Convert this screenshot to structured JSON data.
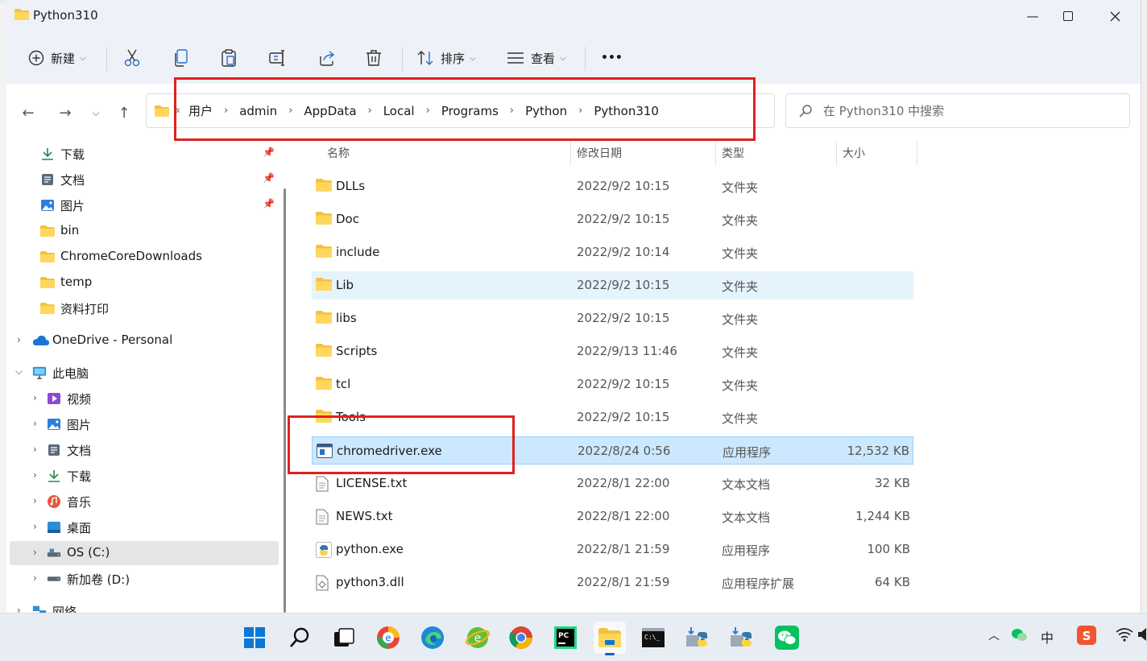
{
  "window": {
    "title": "Python310"
  },
  "toolbar": {
    "new_label": "新建",
    "sort_label": "排序",
    "view_label": "查看",
    "more_label": "•••"
  },
  "address": {
    "overflow": "«",
    "crumbs": [
      "用户",
      "admin",
      "AppData",
      "Local",
      "Programs",
      "Python",
      "Python310"
    ],
    "search_placeholder": "在 Python310 中搜索"
  },
  "nav": {
    "quick": [
      {
        "label": "下载",
        "icon": "download-icon",
        "pinned": true
      },
      {
        "label": "文档",
        "icon": "document-icon",
        "pinned": true
      },
      {
        "label": "图片",
        "icon": "picture-icon",
        "pinned": true
      },
      {
        "label": "bin",
        "icon": "folder-icon"
      },
      {
        "label": "ChromeCoreDownloads",
        "icon": "folder-icon"
      },
      {
        "label": "temp",
        "icon": "folder-icon"
      },
      {
        "label": "资料打印",
        "icon": "folder-icon"
      }
    ],
    "onedrive": "OneDrive - Personal",
    "thispc": "此电脑",
    "pc_items": [
      {
        "label": "视频",
        "icon": "video-icon"
      },
      {
        "label": "图片",
        "icon": "picture-icon"
      },
      {
        "label": "文档",
        "icon": "document-icon"
      },
      {
        "label": "下载",
        "icon": "download-icon"
      },
      {
        "label": "音乐",
        "icon": "music-icon"
      },
      {
        "label": "桌面",
        "icon": "desktop-icon"
      },
      {
        "label": "OS (C:)",
        "icon": "drive-icon"
      },
      {
        "label": "新加卷 (D:)",
        "icon": "drive-icon"
      }
    ],
    "network": "网络"
  },
  "columns": {
    "name": "名称",
    "date": "修改日期",
    "type": "类型",
    "size": "大小"
  },
  "files": [
    {
      "name": "DLLs",
      "date": "2022/9/2 10:15",
      "type": "文件夹",
      "size": "",
      "icon": "folder-icon"
    },
    {
      "name": "Doc",
      "date": "2022/9/2 10:15",
      "type": "文件夹",
      "size": "",
      "icon": "folder-icon"
    },
    {
      "name": "include",
      "date": "2022/9/2 10:14",
      "type": "文件夹",
      "size": "",
      "icon": "folder-icon"
    },
    {
      "name": "Lib",
      "date": "2022/9/2 10:15",
      "type": "文件夹",
      "size": "",
      "icon": "folder-icon"
    },
    {
      "name": "libs",
      "date": "2022/9/2 10:15",
      "type": "文件夹",
      "size": "",
      "icon": "folder-icon"
    },
    {
      "name": "Scripts",
      "date": "2022/9/13 11:46",
      "type": "文件夹",
      "size": "",
      "icon": "folder-icon"
    },
    {
      "name": "tcl",
      "date": "2022/9/2 10:15",
      "type": "文件夹",
      "size": "",
      "icon": "folder-icon"
    },
    {
      "name": "Tools",
      "date": "2022/9/2 10:15",
      "type": "文件夹",
      "size": "",
      "icon": "folder-icon"
    },
    {
      "name": "chromedriver.exe",
      "date": "2022/8/24 0:56",
      "type": "应用程序",
      "size": "12,532 KB",
      "icon": "exe-icon"
    },
    {
      "name": "LICENSE.txt",
      "date": "2022/8/1 22:00",
      "type": "文本文档",
      "size": "32 KB",
      "icon": "text-file-icon"
    },
    {
      "name": "NEWS.txt",
      "date": "2022/8/1 22:00",
      "type": "文本文档",
      "size": "1,244 KB",
      "icon": "text-file-icon"
    },
    {
      "name": "python.exe",
      "date": "2022/8/1 21:59",
      "type": "应用程序",
      "size": "100 KB",
      "icon": "python-exe-icon"
    },
    {
      "name": "python3.dll",
      "date": "2022/8/1 21:59",
      "type": "应用程序扩展",
      "size": "64 KB",
      "icon": "dll-icon"
    }
  ],
  "tray": {
    "ime": "中"
  },
  "colors": {
    "accent": "#0067c0",
    "selection": "#cce8ff",
    "annotation": "#e02020",
    "folder": "#f4c13e"
  }
}
